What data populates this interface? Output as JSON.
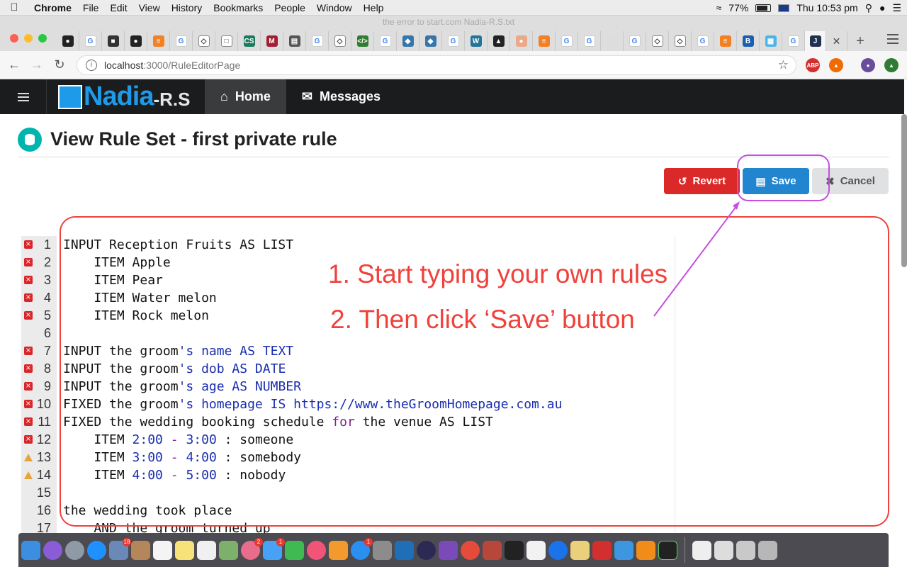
{
  "menubar": {
    "app": "Chrome",
    "items": [
      "File",
      "Edit",
      "View",
      "History",
      "Bookmarks",
      "People",
      "Window",
      "Help"
    ],
    "battery": "77%",
    "clock": "Thu 10:53 pm"
  },
  "window_hint": "the error to start.com Nadia-R.S.txt",
  "address": {
    "host": "localhost",
    "path": ":3000/RuleEditorPage"
  },
  "app_nav": {
    "logo_main": "Nadia",
    "logo_sub": "-R.S",
    "items": [
      {
        "label": "Home",
        "icon": "home-icon"
      },
      {
        "label": "Messages",
        "icon": "envelope-icon"
      }
    ]
  },
  "page": {
    "title": "View Rule Set - first private rule"
  },
  "buttons": {
    "revert": "Revert",
    "save": "Save",
    "cancel": "Cancel"
  },
  "editor": {
    "lines": [
      {
        "n": "1",
        "mark": "error",
        "text": "INPUT Reception Fruits AS LIST"
      },
      {
        "n": "2",
        "mark": "error",
        "text": "    ITEM Apple"
      },
      {
        "n": "3",
        "mark": "error",
        "text": "    ITEM Pear"
      },
      {
        "n": "4",
        "mark": "error",
        "text": "    ITEM Water melon"
      },
      {
        "n": "5",
        "mark": "error",
        "text": "    ITEM Rock melon"
      },
      {
        "n": "6",
        "mark": "",
        "text": ""
      },
      {
        "n": "7",
        "mark": "error",
        "text": "INPUT the groom's name AS TEXT"
      },
      {
        "n": "8",
        "mark": "error",
        "text": "INPUT the groom's dob AS DATE"
      },
      {
        "n": "9",
        "mark": "error",
        "text": "INPUT the groom's age AS NUMBER"
      },
      {
        "n": "10",
        "mark": "error",
        "text": "FIXED the groom's homepage IS https://www.theGroomHomepage.com.au"
      },
      {
        "n": "11",
        "mark": "error",
        "text": "FIXED the wedding booking schedule for the venue AS LIST"
      },
      {
        "n": "12",
        "mark": "error",
        "text": "    ITEM 2:00 - 3:00 : someone"
      },
      {
        "n": "13",
        "mark": "warning",
        "text": "    ITEM 3:00 - 4:00 : somebody"
      },
      {
        "n": "14",
        "mark": "warning",
        "text": "    ITEM 4:00 - 5:00 : nobody"
      },
      {
        "n": "15",
        "mark": "",
        "text": ""
      },
      {
        "n": "16",
        "mark": "",
        "text": "the wedding took place"
      },
      {
        "n": "17",
        "mark": "",
        "text": "    AND the groom turned up"
      }
    ]
  },
  "annotations": {
    "step1": "1. Start typing your own rules",
    "step2": "2. Then click ‘Save’ button",
    "color": "#f0413a",
    "arrow_color": "#c64fe0"
  },
  "colors": {
    "revert": "#db2828",
    "save": "#2185d0",
    "cancel": "#e0e1e2",
    "navbar": "#1b1c1d",
    "logo": "#1e9be8",
    "db_icon": "#00b5ad"
  }
}
